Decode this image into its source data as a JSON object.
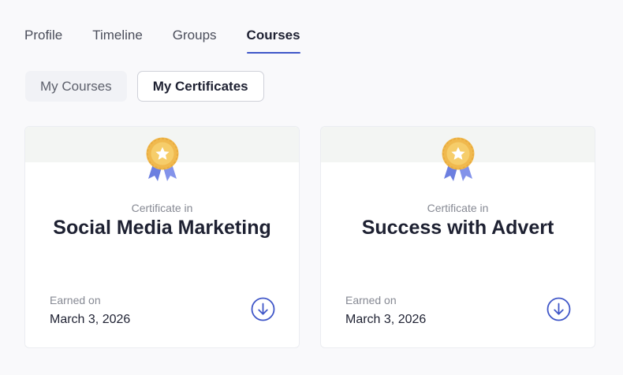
{
  "tabs": [
    {
      "label": "Profile"
    },
    {
      "label": "Timeline"
    },
    {
      "label": "Groups"
    },
    {
      "label": "Courses"
    }
  ],
  "subtabs": {
    "my_courses": "My Courses",
    "my_certificates": "My Certificates"
  },
  "certificates": [
    {
      "label": "Certificate in",
      "title": "Social Media Marketing",
      "earned_label": "Earned on",
      "earned_date": "March 3, 2026"
    },
    {
      "label": "Certificate in",
      "title": "Success with Advert",
      "earned_label": "Earned on",
      "earned_date": "March 3, 2026"
    }
  ],
  "colors": {
    "accent": "#3f56c8",
    "medal_gold": "#f4c55c",
    "ribbon": "#6c7fe0"
  },
  "icons": {
    "badge": "award-medal-icon",
    "download": "download-circle-icon"
  }
}
